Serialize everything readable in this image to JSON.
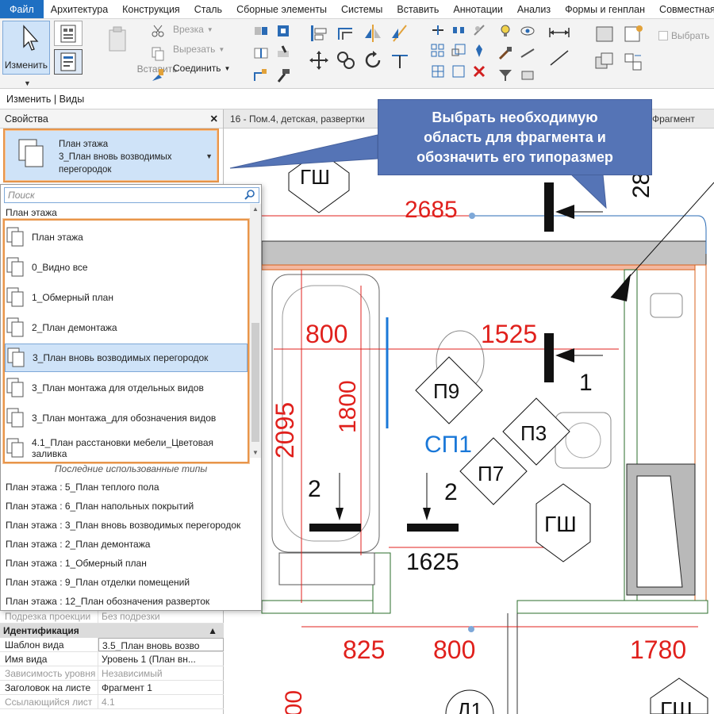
{
  "menu": {
    "tabs": [
      "Файл",
      "Архитектура",
      "Конструкция",
      "Сталь",
      "Сборные элементы",
      "Системы",
      "Вставить",
      "Аннотации",
      "Анализ",
      "Формы и генплан",
      "Совместная ра"
    ]
  },
  "ribbon": {
    "modify_label": "Изменить",
    "paste_label": "Вставить",
    "cut_label": "Врезка",
    "cutout_label": "Вырезать",
    "join_label": "Соединить",
    "select_label": "Выбрать"
  },
  "context_bar": "Изменить | Виды",
  "properties": {
    "title": "Свойства",
    "type_family": "План этажа",
    "type_name": "3_План вновь возводимых перегородок",
    "rows_top": [
      {
        "key": "Подрезка проекции",
        "value": "Без подрезки"
      }
    ],
    "section_identification": "Идентификация",
    "rows_ident": [
      {
        "key": "Шаблон вида",
        "value": "3.5_План вновь возво",
        "grey": false
      },
      {
        "key": "Имя вида",
        "value": "Уровень 1 (План вн...",
        "grey": false
      },
      {
        "key": "Зависимость уровня",
        "value": "Независимый",
        "grey": true
      },
      {
        "key": "Заголовок на листе",
        "value": "Фрагмент 1",
        "grey": false
      },
      {
        "key": "Ссылающийся лист",
        "value": "4.1",
        "grey": true
      }
    ]
  },
  "dropdown": {
    "search_placeholder": "Поиск",
    "group_title": "План этажа",
    "types": [
      "План этажа",
      "0_Видно все",
      "1_Обмерный план",
      "2_План демонтажа",
      "3_План вновь возводимых перегородок",
      "3_План монтажа для отдельных видов",
      "3_План монтажа_для обозначения видов",
      "4.1_План расстановки мебели_Цветовая заливка"
    ],
    "selected_index": 4,
    "recent_title": "Последние использованные типы",
    "recent": [
      "План этажа : 5_План теплого пола",
      "План этажа : 6_План напольных покрытий",
      "План этажа : 3_План вновь возводимых перегородок",
      "План этажа : 2_План демонтажа",
      "План этажа : 1_Обмерный план",
      "План этажа : 9_План отделки помещений",
      "План этажа : 12_План обозначения разверток"
    ]
  },
  "view_tabs": {
    "tab1": "16 - Пом.4, детская, развертки",
    "tab2": "Фрагмент сану"
  },
  "callout": {
    "lines": [
      "Выбрать необходимую",
      "область для фрагмента и",
      "обозначить его типоразмер"
    ]
  },
  "drawing": {
    "dim_labels": [
      "2685",
      "800",
      "1525",
      "2095",
      "1800",
      "1625",
      "825",
      "800",
      "1780",
      "28",
      "1",
      "2",
      "2"
    ],
    "tag_labels": [
      "ГШ",
      "П9",
      "П3",
      "П7",
      "ГШ",
      "ГШ",
      "Д1"
    ],
    "room_label": "СП1"
  },
  "colors": {
    "accent": "#1e6fc2",
    "highlight": "#e8954a",
    "selection": "#cfe3f8",
    "callout": "#5574b6",
    "dimension": "#e0201c",
    "room_text": "#1a78d8"
  }
}
